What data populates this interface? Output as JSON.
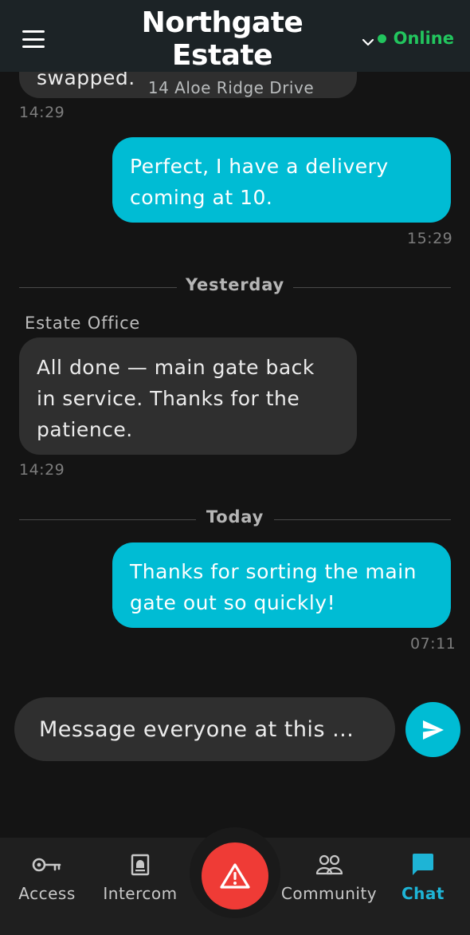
{
  "header": {
    "title": "Northgate Estate",
    "subtitle": "14 Aloe Ridge Drive",
    "status": "Online",
    "status_color": "#22c55e"
  },
  "messages": [
    {
      "direction": "incoming",
      "text": "swapped.",
      "time": "14:29"
    },
    {
      "direction": "outgoing",
      "text": "Perfect, I have a delivery coming at 10.",
      "time": "15:29"
    },
    {
      "divider": "Yesterday"
    },
    {
      "direction": "incoming",
      "sender": "Estate Office",
      "text": "All done — main gate back in service. Thanks for the patience.",
      "time": "14:29"
    },
    {
      "divider": "Today"
    },
    {
      "direction": "outgoing",
      "text": "Thanks for sorting the main gate out so quickly!",
      "time": "07:11"
    }
  ],
  "chat": {
    "partial_text": "swapped.",
    "partial_time": "14:29",
    "msg1_line1": "Perfect, I have a delivery",
    "msg1_line2": "coming at 10.",
    "msg1_time": "15:29",
    "divider_yesterday": "Yesterday",
    "sender": "Estate Office",
    "msg2_line1": "All done — main gate back",
    "msg2_line2": "in service. Thanks for the",
    "msg2_line3": "patience.",
    "msg2_time": "14:29",
    "divider_today": "Today",
    "msg3_line1": "Thanks for sorting the main",
    "msg3_line2": "gate out so quickly!",
    "msg3_time": "07:11"
  },
  "composer": {
    "placeholder": "Message everyone at this ...",
    "send_icon": "send-icon"
  },
  "nav": {
    "items": [
      {
        "label": "Access",
        "icon": "key-icon"
      },
      {
        "label": "Intercom",
        "icon": "bell-icon"
      },
      {
        "label": "Community",
        "icon": "people-icon"
      },
      {
        "label": "Chat",
        "icon": "chat-icon",
        "active": true
      }
    ],
    "sos_icon": "warning-icon",
    "sos_color": "#ef3b36",
    "accent": "#00bcd4"
  }
}
